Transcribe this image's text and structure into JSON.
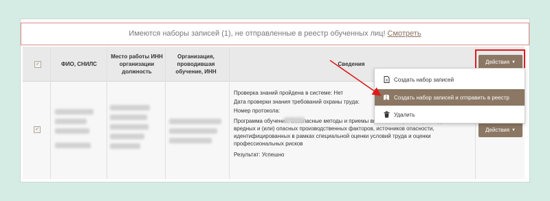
{
  "notice": {
    "text": "Имеются наборы записей (1), не отправленные в реестр обученных лиц!",
    "link": "Смотреть"
  },
  "table": {
    "headers": {
      "fio": "ФИО, СНИЛС",
      "work": "Место работы ИНН организации должность",
      "org": "Организация, проводившая обучение, ИНН",
      "details": "Сведения"
    },
    "row": {
      "details": {
        "check": "Проверка знаний пройдена в системе: Нет",
        "date": "Дата проверки знания требований охраны труда:",
        "protocol": "Номер протокола:",
        "program": "Программа обучения: Безопасные методы и приемы выполнения работ при воздействии вредных и (или) опасных производственных факторов, источников опасности, идентифицированных в рамках специальной оценки условий труда и оценки профессиональных рисков",
        "result": "Результат: Успешно"
      },
      "actions_label": "Действия"
    }
  },
  "header_actions": {
    "label": "Действия"
  },
  "dropdown": {
    "items": [
      {
        "label": "Создать набор записей",
        "icon": "file-icon"
      },
      {
        "label": "Создать набор записей и отправить в реестр",
        "icon": "book-send-icon"
      },
      {
        "label": "Удалить",
        "icon": "trash-icon"
      }
    ]
  },
  "colors": {
    "accent": "#8b7763",
    "annotation": "#e01919",
    "background": "#d4ece4"
  }
}
